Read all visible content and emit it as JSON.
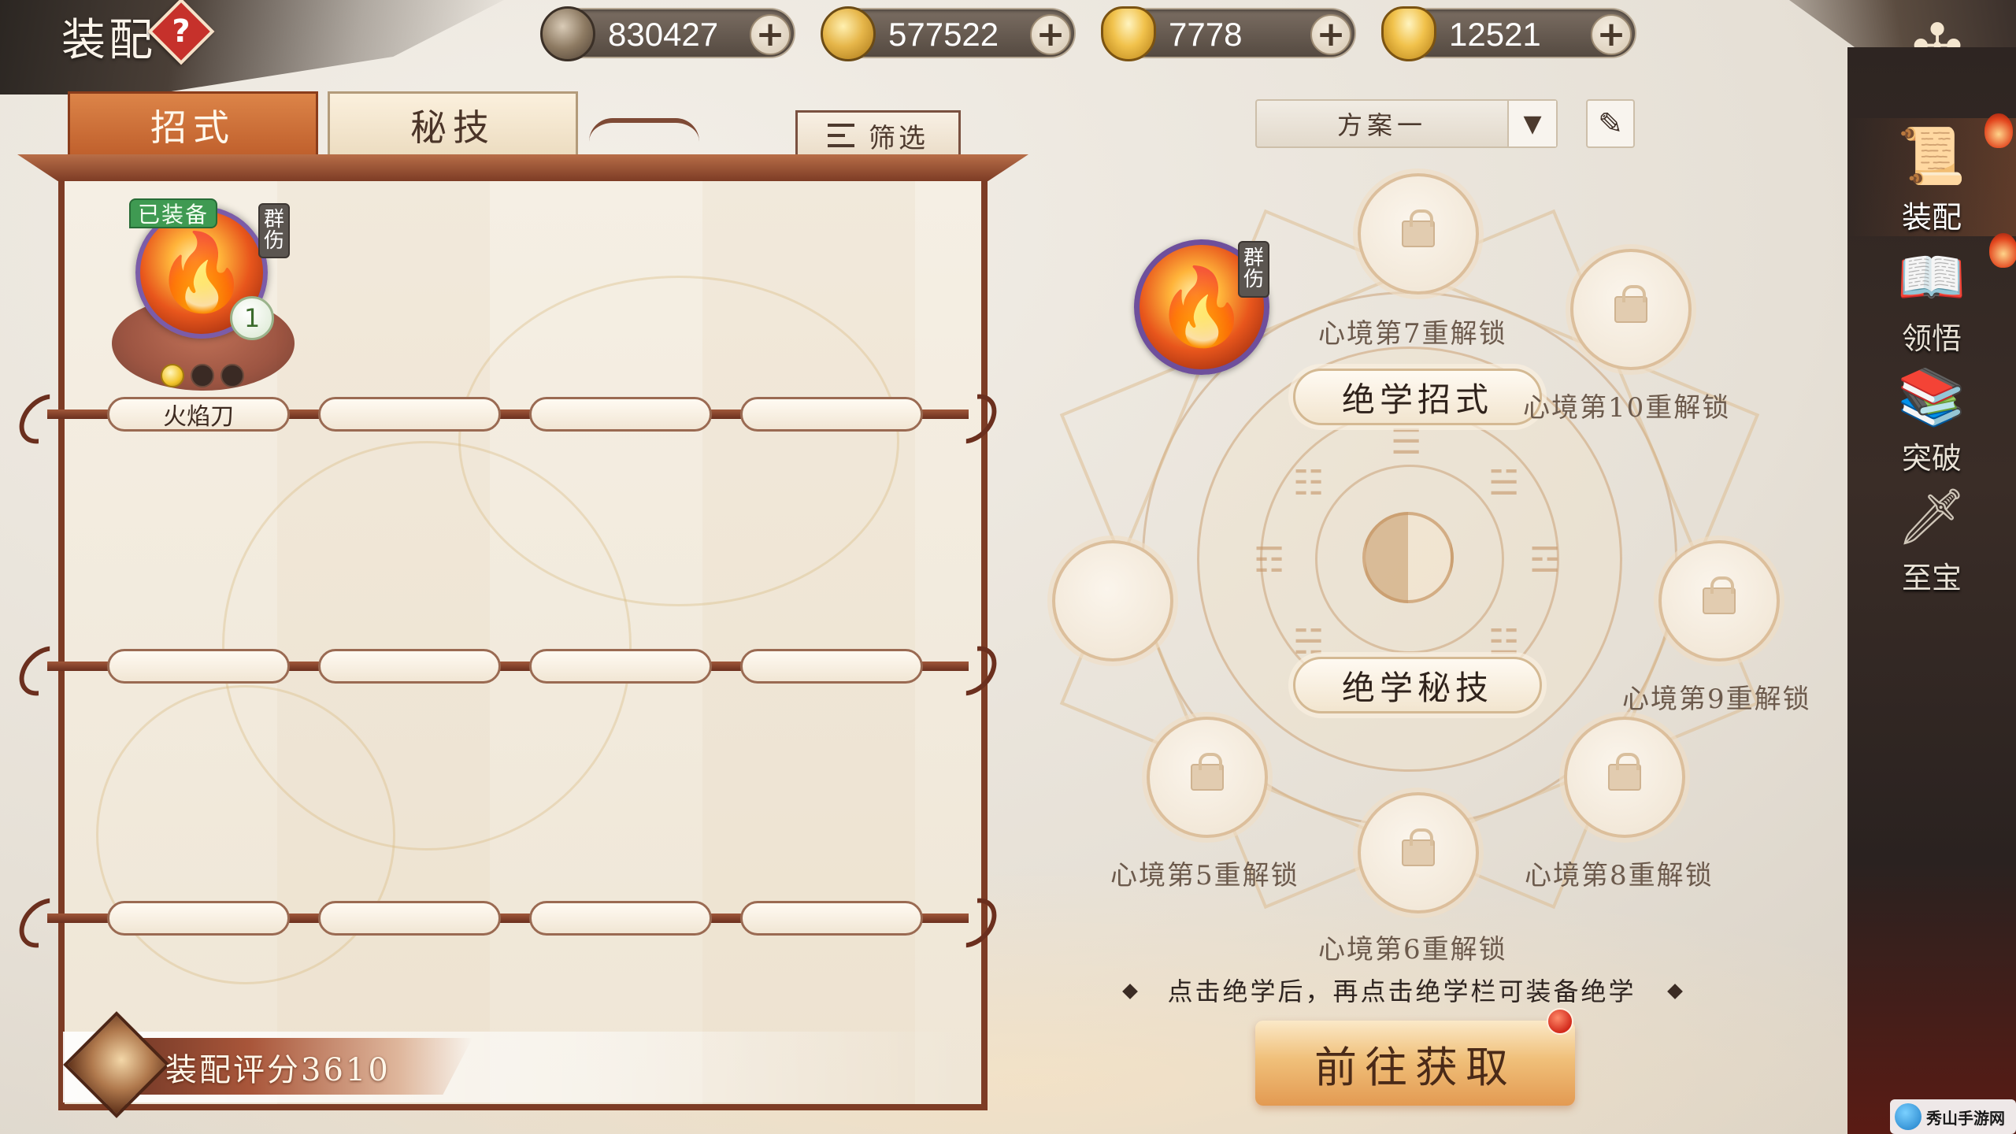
{
  "header": {
    "title": "装配",
    "help_icon": "question-diamond",
    "close_icon": "crossed-swords-emblem"
  },
  "currencies": [
    {
      "name": "copper-coin",
      "value": "830427",
      "plus": "+"
    },
    {
      "name": "gold-coin",
      "value": "577522",
      "plus": "+"
    },
    {
      "name": "gold-ingot-locked",
      "value": "7778",
      "plus": "+"
    },
    {
      "name": "gold-ingot",
      "value": "12521",
      "plus": "+"
    }
  ],
  "tabs": {
    "moves": "招式",
    "secrets": "秘技",
    "active": "招式"
  },
  "filter": {
    "label": "筛选"
  },
  "inventory": {
    "skill": {
      "name": "火焰刀",
      "equipped_badge": "已装备",
      "type_tag_1": "群",
      "type_tag_2": "伤",
      "level": "1",
      "stars_total": 3,
      "stars_lit": 1
    },
    "score_label": "装配评分3610"
  },
  "plan": {
    "selected": "方案一",
    "dropdown_arrow": "▼",
    "edit_icon": "✎"
  },
  "wheel": {
    "moves_plate": "绝学招式",
    "secrets_plate": "绝学秘技",
    "equipped_tag_1": "群",
    "equipped_tag_2": "伤",
    "trigrams": [
      "☰",
      "☱",
      "☲",
      "☳",
      "☴",
      "☵",
      "☶",
      "☷"
    ],
    "unlock_7": "心境第7重解锁",
    "unlock_10": "心境第10重解锁",
    "unlock_9": "心境第9重解锁",
    "unlock_5": "心境第5重解锁",
    "unlock_8": "心境第8重解锁",
    "unlock_6": "心境第6重解锁"
  },
  "hint": "点击绝学后，再点击绝学栏可装备绝学",
  "go_button": "前往获取",
  "nav": [
    {
      "label": "装配",
      "icon": "📜"
    },
    {
      "label": "领悟",
      "icon": "📖"
    },
    {
      "label": "突破",
      "icon": "📚"
    },
    {
      "label": "至宝",
      "icon": "🗡"
    }
  ],
  "watermark": "秀山手游网",
  "colors": {
    "accent_tab": "#c8652f",
    "equipped_green": "#3f9a52",
    "frame_brown": "#7d3c25",
    "go_button": "#f0c07a"
  }
}
